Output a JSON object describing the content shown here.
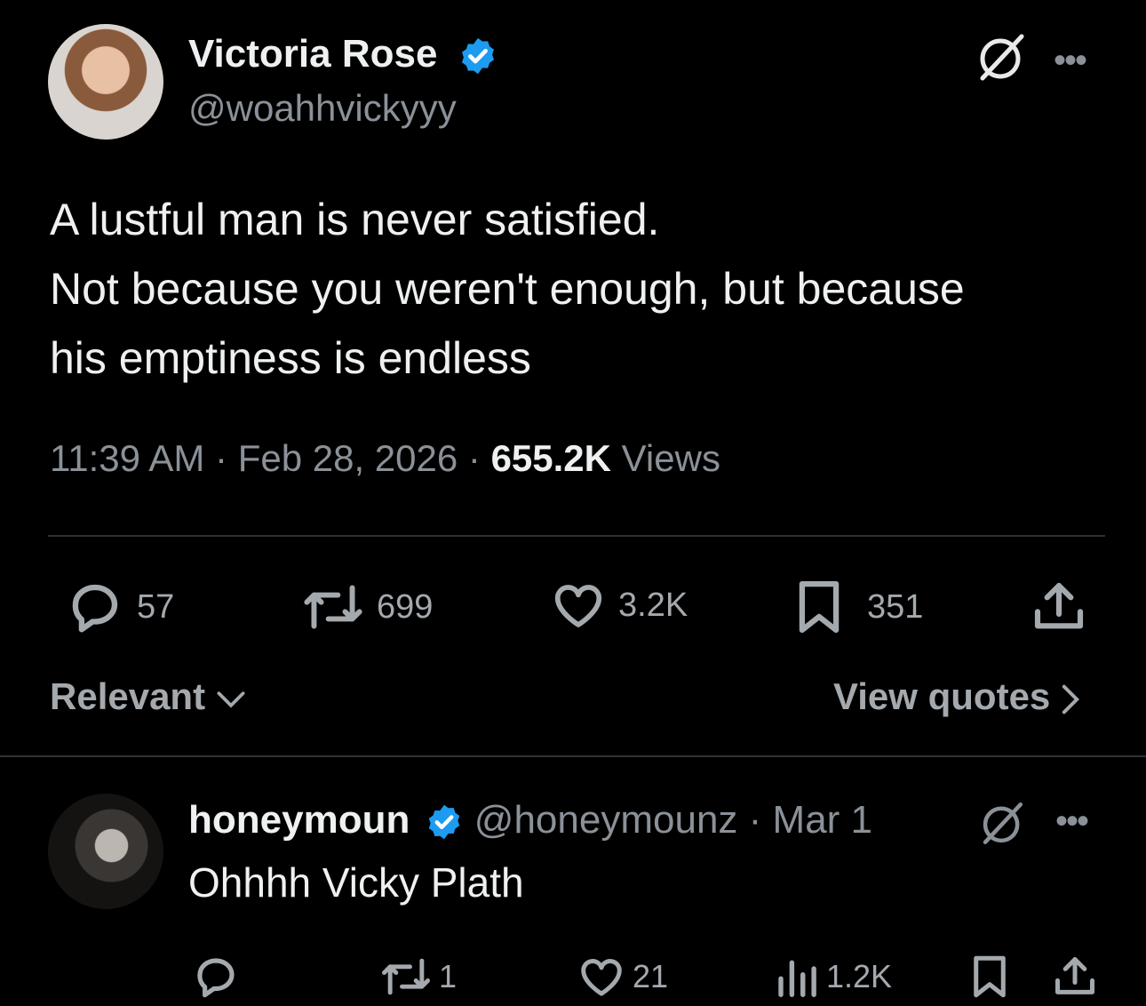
{
  "tweet": {
    "author_name": "Victoria Rose",
    "author_handle": "@woahhvickyyy",
    "text_lines": [
      "A lustful man is never satisfied.",
      "Not because you weren't enough, but because",
      "his emptiness is endless"
    ],
    "time": "11:39 AM",
    "date": "Feb 28, 2026",
    "views_count": "655.2K",
    "views_label": "Views",
    "separator": "·"
  },
  "stats": {
    "replies": "57",
    "reposts": "699",
    "likes": "3.2K",
    "bookmarks": "351"
  },
  "links": {
    "sort": "Relevant",
    "quotes": "View quotes"
  },
  "reply": {
    "author_name": "honeymoun",
    "author_handle": "@honeymounz",
    "date": "Mar 1",
    "text": "Ohhhh Vicky Plath",
    "reposts": "1",
    "likes": "21",
    "views": "1.2K"
  },
  "colors": {
    "background": "#000000",
    "verified": "#1d9bf0",
    "muted": "#8b9198"
  },
  "icons": [
    "verified-badge-icon",
    "grok-icon",
    "more-icon",
    "reply-icon",
    "repost-icon",
    "like-icon",
    "bookmark-icon",
    "share-icon",
    "views-icon",
    "chevron-down-icon",
    "chevron-right-icon"
  ]
}
